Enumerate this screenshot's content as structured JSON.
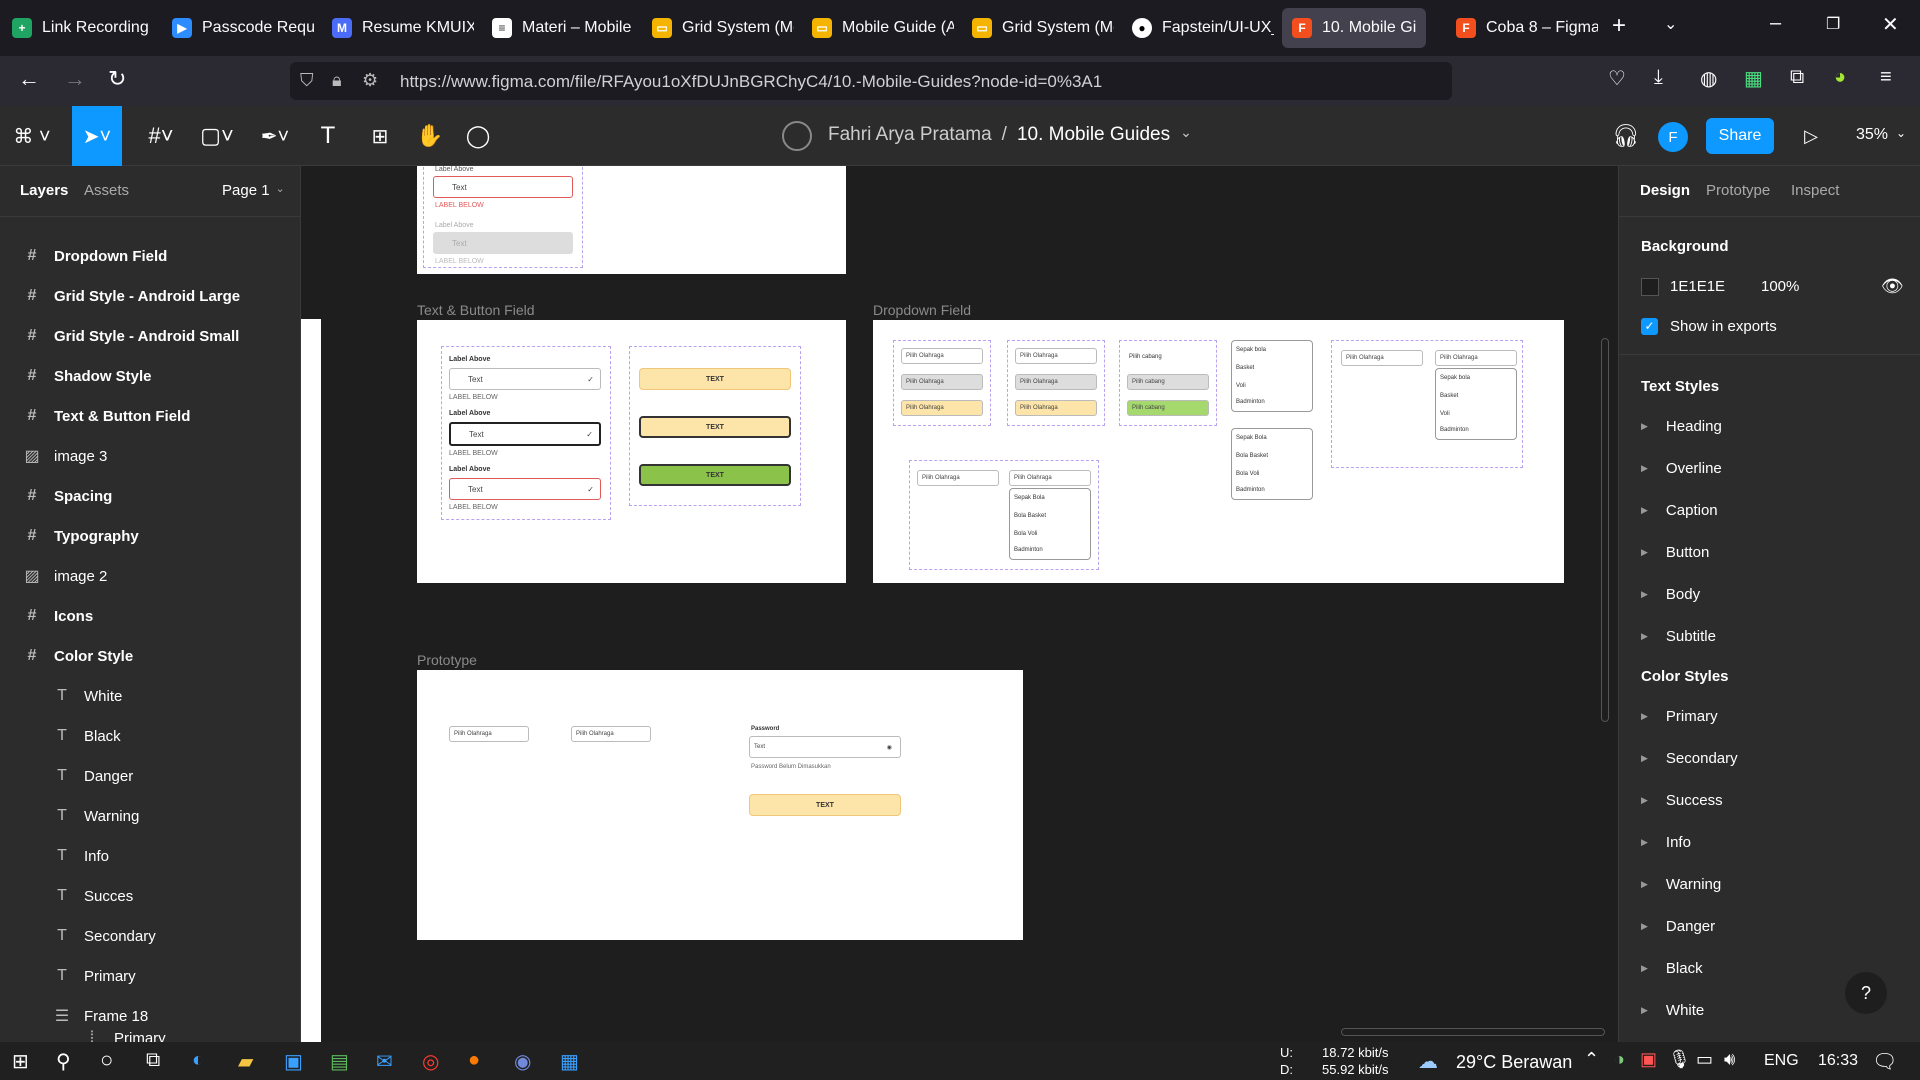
{
  "browser": {
    "tabs": [
      {
        "label": "Link Recording",
        "icon": "green-sheet-icon",
        "color": "#1fa463"
      },
      {
        "label": "Passcode Requir",
        "icon": "zoom-icon",
        "color": "#2d8cff"
      },
      {
        "label": "Resume KMUIX",
        "icon": "m-icon",
        "color": "#4a6cf7"
      },
      {
        "label": "Materi – Mobile",
        "icon": "doc-icon",
        "color": "#ffffff"
      },
      {
        "label": "Grid System (Mc",
        "icon": "slides-icon",
        "color": "#f4b400"
      },
      {
        "label": "Mobile Guide (A",
        "icon": "slides-icon",
        "color": "#f4b400"
      },
      {
        "label": "Grid System (Mc",
        "icon": "slides-icon",
        "color": "#f4b400"
      },
      {
        "label": "Fapstein/UI-UX_",
        "icon": "github-icon",
        "color": "#ffffff"
      },
      {
        "label": "10. Mobile Gi",
        "icon": "figma-icon",
        "color": "#f24e1e"
      },
      {
        "label": "Coba 8 – Figma",
        "icon": "figma-icon",
        "color": "#f24e1e"
      }
    ],
    "url": "https://www.figma.com/file/RFAyou1oXfDUJnBGRChyC4/10.-Mobile-Guides?node-id=0%3A1"
  },
  "figma": {
    "owner": "Fahri Arya Pratama",
    "separator": "/",
    "file_name": "10. Mobile Guides",
    "avatar_letter": "F",
    "share_label": "Share",
    "zoom": "35%",
    "accent": "#0d99ff"
  },
  "left_panel": {
    "tabs": {
      "layers": "Layers",
      "assets": "Assets"
    },
    "page": "Page 1",
    "layers": [
      {
        "label": "Dropdown Field",
        "type": "frame"
      },
      {
        "label": "Grid Style - Android Large",
        "type": "frame"
      },
      {
        "label": "Grid Style - Android Small",
        "type": "frame"
      },
      {
        "label": "Shadow Style",
        "type": "frame"
      },
      {
        "label": "Text & Button Field",
        "type": "frame"
      },
      {
        "label": "image 3",
        "type": "image"
      },
      {
        "label": "Spacing",
        "type": "frame"
      },
      {
        "label": "Typography",
        "type": "frame"
      },
      {
        "label": "image 2",
        "type": "image"
      },
      {
        "label": "Icons",
        "type": "frame"
      },
      {
        "label": "Color Style",
        "type": "frame"
      },
      {
        "label": "White",
        "type": "text"
      },
      {
        "label": "Black",
        "type": "text"
      },
      {
        "label": "Danger",
        "type": "text"
      },
      {
        "label": "Warning",
        "type": "text"
      },
      {
        "label": "Info",
        "type": "text"
      },
      {
        "label": "Succes",
        "type": "text"
      },
      {
        "label": "Secondary",
        "type": "text"
      },
      {
        "label": "Primary",
        "type": "text"
      },
      {
        "label": "Frame 18",
        "type": "autolayout"
      },
      {
        "label": "Primary",
        "type": "component"
      }
    ]
  },
  "canvas": {
    "frames": {
      "text_button": "Text & Button Field",
      "dropdown": "Dropdown Field",
      "prototype": "Prototype"
    },
    "mini": {
      "label_above": "Label Above",
      "text": "Text",
      "label_below": "LABEL BELOW",
      "button_text": "TEXT",
      "dropdown_placeholder": "Pilih Olahraga",
      "branch_placeholder": "Pilih cabang",
      "options_a": [
        "Sepak bola",
        "Basket",
        "Voli",
        "Badminton"
      ],
      "options_b": [
        "Sepak Bola",
        "Bola Basket",
        "Bola Voli",
        "Badminton"
      ],
      "password_label": "Password",
      "password_hint": "Password Belum Dimasukkan"
    }
  },
  "right_panel": {
    "tabs": {
      "design": "Design",
      "prototype": "Prototype",
      "inspect": "Inspect"
    },
    "background_heading": "Background",
    "bg_hex": "1E1E1E",
    "bg_opacity": "100%",
    "bg_color": "#1e1e1e",
    "show_exports": "Show in exports",
    "text_styles_heading": "Text Styles",
    "text_styles": [
      "Heading",
      "Overline",
      "Caption",
      "Button",
      "Body",
      "Subtitle"
    ],
    "color_styles_heading": "Color Styles",
    "color_styles": [
      "Primary",
      "Secondary",
      "Success",
      "Info",
      "Warning",
      "Danger",
      "Black",
      "White"
    ],
    "help": "?"
  },
  "taskbar": {
    "net_up_label": "U:",
    "net_up": "18.72 kbit/s",
    "net_down_label": "D:",
    "net_down": "55.92 kbit/s",
    "weather": "29°C  Berawan",
    "lang": "ENG",
    "time": "16:33"
  }
}
